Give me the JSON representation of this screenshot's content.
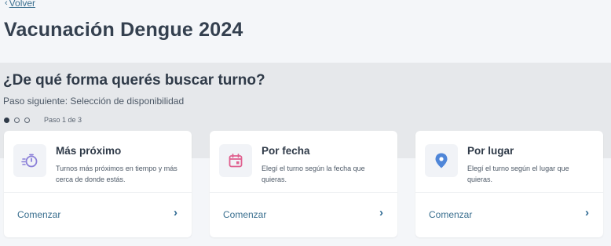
{
  "header": {
    "back_label": "Volver",
    "title": "Vacunación Dengue 2024"
  },
  "wizard": {
    "question": "¿De qué forma querés buscar turno?",
    "next_step": "Paso siguiente: Selección de disponibilidad",
    "step_label": "Paso 1 de 3",
    "current_step": 1,
    "total_steps": 3
  },
  "options": [
    {
      "title": "Más próximo",
      "description": "Turnos más próximos en tiempo y más cerca de donde estás.",
      "action": "Comenzar",
      "icon": "timer-icon",
      "icon_color": "#8a7fd8"
    },
    {
      "title": "Por fecha",
      "description": "Elegí el turno según la fecha que quieras.",
      "action": "Comenzar",
      "icon": "calendar-icon",
      "icon_color": "#e0608f"
    },
    {
      "title": "Por lugar",
      "description": "Elegí el turno según el lugar que quieras.",
      "action": "Comenzar",
      "icon": "location-pin-icon",
      "icon_color": "#4f86d8"
    }
  ],
  "colors": {
    "accent": "#3a6f8f",
    "text": "#2f3a48",
    "band": "#e6e8eb"
  }
}
